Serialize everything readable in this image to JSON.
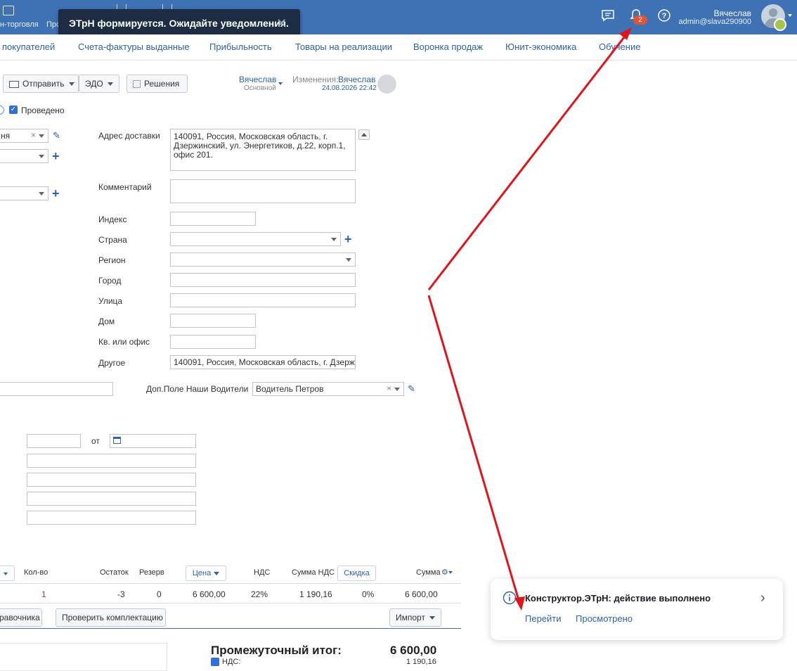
{
  "topbar": {
    "nav_items": [
      "н-торговля",
      "Про"
    ],
    "user_name": "Вячеслав",
    "user_email": "admin@slava290900",
    "notifications_count": "2"
  },
  "toast": {
    "message": "ЭТрН формируется. Ожидайте уведомления.",
    "close_glyph": "✕"
  },
  "tabs": [
    "покупателей",
    "Счета-фактуры выданные",
    "Прибыльность",
    "Товары на реализации",
    "Воронка продаж",
    "Юнит-экономика",
    "Обучение"
  ],
  "toolbar": {
    "send_label": "Отправить",
    "edo_label": "ЭДО",
    "solutions_label": "Решения",
    "owner_name": "Вячеслав",
    "owner_role": "Основной",
    "changes_label": "Изменения:",
    "changes_user": "Вячеслав",
    "changes_date": "24.08.2026 22:42"
  },
  "status": {
    "posted_label": "Проведено",
    "posted": true
  },
  "left_fields": {
    "first_value": "ня"
  },
  "address": {
    "delivery_label": "Адрес доставки",
    "delivery_value": "140091, Россия, Московская область, г. Дзержинский,  ул. Энергетиков, д.22, корп.1, офис 201.",
    "comment_label": "Комментарий",
    "index_label": "Индекс",
    "country_label": "Страна",
    "region_label": "Регион",
    "city_label": "Город",
    "street_label": "Улица",
    "house_label": "Дом",
    "apt_label": "Кв. или офис",
    "other_label": "Другое",
    "other_value": "140091, Россия, Московская область, г. Дзержинс"
  },
  "drivers": {
    "label": "Доп.Поле Наши Водители",
    "value": "Водитель Петров"
  },
  "doc": {
    "from_label": "от"
  },
  "table": {
    "headers": {
      "qty": "Кол-во",
      "stock": "Остаток",
      "reserve": "Резерв",
      "price": "Цена",
      "vat": "НДС",
      "vat_sum": "Сумма НДС",
      "discount": "Скидка",
      "sum": "Сумма"
    },
    "row": {
      "qty": "1",
      "stock": "-3",
      "reserve": "0",
      "price": "6 600,00",
      "vat": "22%",
      "vat_sum": "1 190,16",
      "discount": "0%",
      "sum": "6 600,00"
    }
  },
  "actions": {
    "from_catalog": "равочника",
    "check_kit": "Проверить комплектацию",
    "import": "Импорт"
  },
  "totals": {
    "subtotal_label": "Промежуточный итог:",
    "subtotal_value": "6 600,00",
    "vat_label": "НДС:",
    "vat_value": "1 190,16"
  },
  "notification": {
    "title": "Конструктор.ЭТрН: действие выполнено",
    "go_link": "Перейти",
    "viewed_link": "Просмотрено"
  },
  "colors": {
    "topbar": "#3f71b5",
    "link": "#2f62a6",
    "badge": "#e05536",
    "arrow": "#e0141b",
    "toast": "#1d2c42"
  }
}
